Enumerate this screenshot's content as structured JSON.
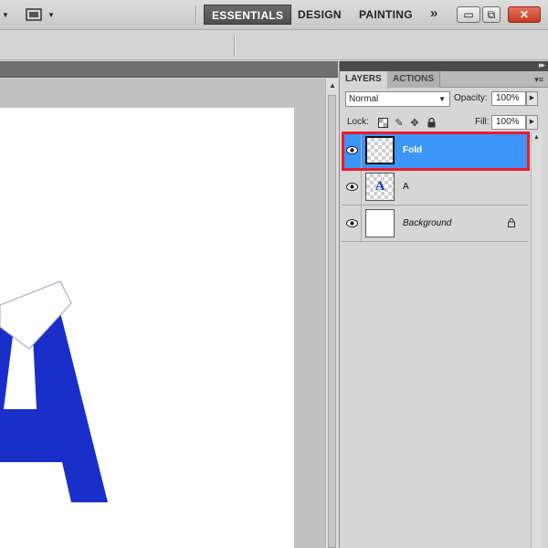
{
  "workspace": {
    "items": [
      {
        "label": "ESSENTIALS",
        "active": true
      },
      {
        "label": "DESIGN",
        "active": false
      },
      {
        "label": "PAINTING",
        "active": false
      }
    ],
    "more_glyph": "»"
  },
  "window_controls": {
    "minimize": "▭",
    "restore": "⧉",
    "close": "✕"
  },
  "panel": {
    "tabs": [
      "LAYERS",
      "ACTIONS"
    ],
    "blend_mode": "Normal",
    "opacity_label": "Opacity:",
    "opacity_value": "100%",
    "lock_label": "Lock:",
    "fill_label": "Fill:",
    "fill_value": "100%",
    "layers": [
      {
        "name": "Fold",
        "selected": true,
        "visible": true,
        "thumb": "transparent",
        "locked": false
      },
      {
        "name": "A",
        "selected": false,
        "visible": true,
        "thumb": "letter",
        "thumb_text": "A",
        "locked": false
      },
      {
        "name": "Background",
        "selected": false,
        "visible": true,
        "thumb": "white",
        "locked": true
      }
    ]
  },
  "colors": {
    "letter_fill": "#1a2fc9",
    "selected_layer": "#3d95f7",
    "highlight_box": "#e81c2b"
  },
  "icons": [
    "screen-mode-icon",
    "eye-icon",
    "lock-icon",
    "brush-icon",
    "move-icon",
    "transparency-icon",
    "panel-menu-icon"
  ]
}
